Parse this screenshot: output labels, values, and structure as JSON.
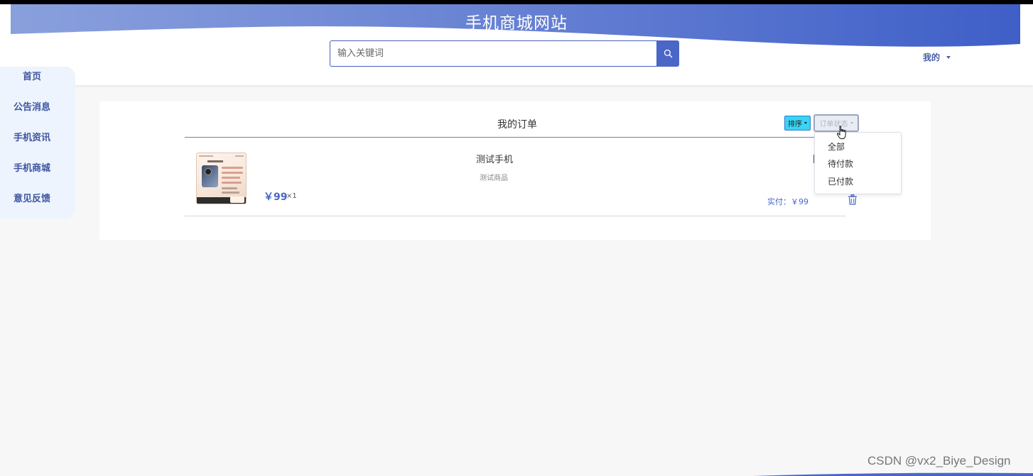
{
  "header": {
    "title": "手机商城网站",
    "search_placeholder": "输入关键词",
    "user_menu": "我的"
  },
  "sidebar": {
    "items": [
      {
        "label": "首页"
      },
      {
        "label": "公告消息"
      },
      {
        "label": "手机资讯"
      },
      {
        "label": "手机商城"
      },
      {
        "label": "意见反馈"
      }
    ]
  },
  "orders": {
    "title": "我的订单",
    "sort_label": "排序",
    "status_label": "订单状态",
    "status_options": [
      "全部",
      "待付款",
      "已付款"
    ],
    "items": [
      {
        "name": "测试手机",
        "description": "测试商品",
        "price": "￥99",
        "quantity": "×1",
        "paid": "实付：￥99"
      }
    ]
  },
  "watermark": "CSDN @vx2_Biye_Design",
  "colors": {
    "accent": "#4a66c6",
    "sort_button": "#3ad4f4",
    "sidebar_bg": "#edf4fd",
    "page_bg": "#f7f7f7"
  }
}
